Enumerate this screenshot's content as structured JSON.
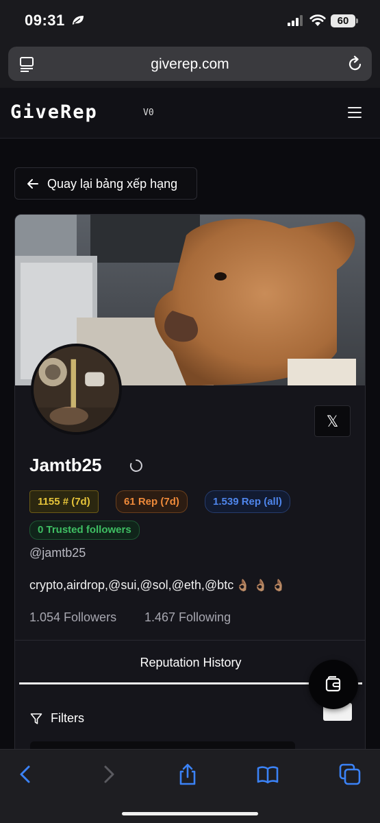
{
  "status_bar": {
    "time": "09:31",
    "battery": "60"
  },
  "browser": {
    "url": "giverep.com"
  },
  "site": {
    "logo": "GiveRep",
    "version": "V0"
  },
  "back_button": {
    "label": "Quay lại bảng xếp hạng"
  },
  "profile": {
    "name": "Jamtb25",
    "handle": "@jamtb25",
    "bio": "crypto,airdrop,@sui,@sol,@eth,@btc",
    "bio_emoji": "👌🏽 👌🏽 👌🏽",
    "badges": {
      "rank": "1155 # (7d)",
      "rep_7d": "61 Rep (7d)",
      "rep_all": "1.539 Rep (all)",
      "trusted": "0 Trusted followers"
    },
    "followers": "1.054 Followers",
    "following": "1.467 Following",
    "x_button": "𝕏"
  },
  "tabs": {
    "reputation_history": "Reputation History"
  },
  "filters": {
    "label": "Filters"
  },
  "colors": {
    "rank": "#e6c43a",
    "rep_7d": "#ef8a3a",
    "rep_all": "#4f86ec",
    "trusted": "#3fbf63",
    "ios_blue": "#3b82f6"
  }
}
